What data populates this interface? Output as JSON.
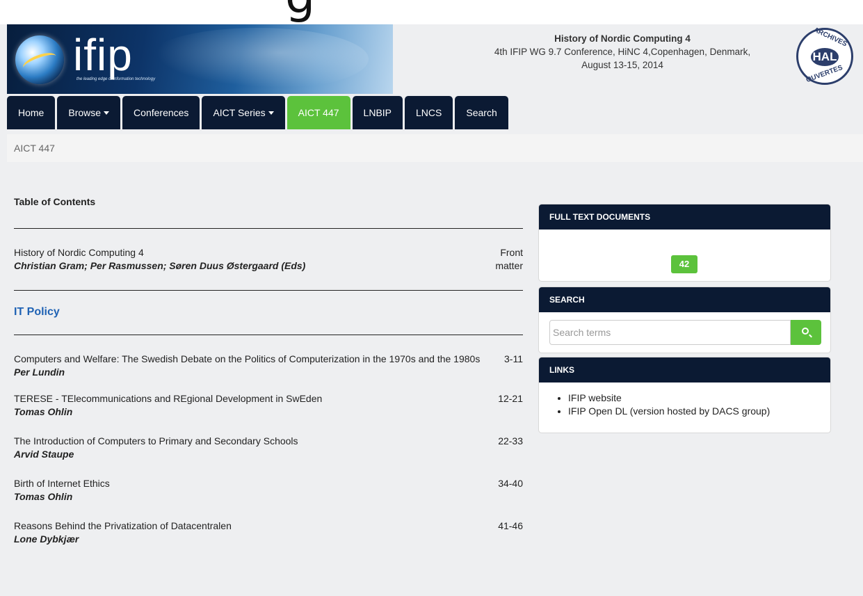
{
  "banner": {
    "logo_text": "ifip",
    "tagline": "the leading edge of information technology"
  },
  "conference": {
    "title": "History of Nordic Computing 4",
    "line2": "4th IFIP WG 9.7 Conference, HiNC 4,Copenhagen, Denmark,",
    "line3": "August 13-15, 2014"
  },
  "hal_logo": {
    "top": "ARCHIVES",
    "center": "HAL",
    "bottom": "OUVERTES"
  },
  "nav": {
    "items": [
      {
        "label": "Home",
        "dropdown": false,
        "active": false
      },
      {
        "label": "Browse",
        "dropdown": true,
        "active": false
      },
      {
        "label": "Conferences",
        "dropdown": false,
        "active": false
      },
      {
        "label": "AICT Series",
        "dropdown": true,
        "active": false
      },
      {
        "label": "AICT 447",
        "dropdown": false,
        "active": true
      },
      {
        "label": "LNBIP",
        "dropdown": false,
        "active": false
      },
      {
        "label": "LNCS",
        "dropdown": false,
        "active": false
      },
      {
        "label": "Search",
        "dropdown": false,
        "active": false
      }
    ]
  },
  "breadcrumb": "AICT 447",
  "toc": {
    "heading": "Table of Contents",
    "front": {
      "title": "History of Nordic Computing 4",
      "authors": "Christian Gram; Per Rasmussen; Søren Duus Østergaard (Eds)",
      "pages_line1": "Front",
      "pages_line2": "matter"
    },
    "section": "IT Policy",
    "papers": [
      {
        "title": "Computers and Welfare: The Swedish Debate on the Politics of Computerization in the 1970s and the 1980s",
        "authors": "Per Lundin",
        "pages": "3-11"
      },
      {
        "title": "TERESE - TElecommunications and REgional Development in SwEden",
        "authors": "Tomas Ohlin",
        "pages": "12-21"
      },
      {
        "title": "The Introduction of Computers to Primary and Secondary Schools",
        "authors": "Arvid Staupe",
        "pages": "22-33"
      },
      {
        "title": "Birth of Internet Ethics",
        "authors": "Tomas Ohlin",
        "pages": "34-40"
      },
      {
        "title": "Reasons Behind the Privatization of Datacentralen",
        "authors": "Lone Dybkjær",
        "pages": "41-46"
      }
    ]
  },
  "sidebar": {
    "fulltext": {
      "title": "FULL TEXT DOCUMENTS",
      "count": "42"
    },
    "search": {
      "title": "SEARCH",
      "placeholder": "Search terms"
    },
    "links": {
      "title": "LINKS",
      "items": [
        "IFIP website",
        "IFIP Open DL (version hosted by DACS group)"
      ]
    }
  },
  "colors": {
    "navy": "#0b1a33",
    "green": "#5cc23c",
    "link_blue": "#1f62b4"
  }
}
